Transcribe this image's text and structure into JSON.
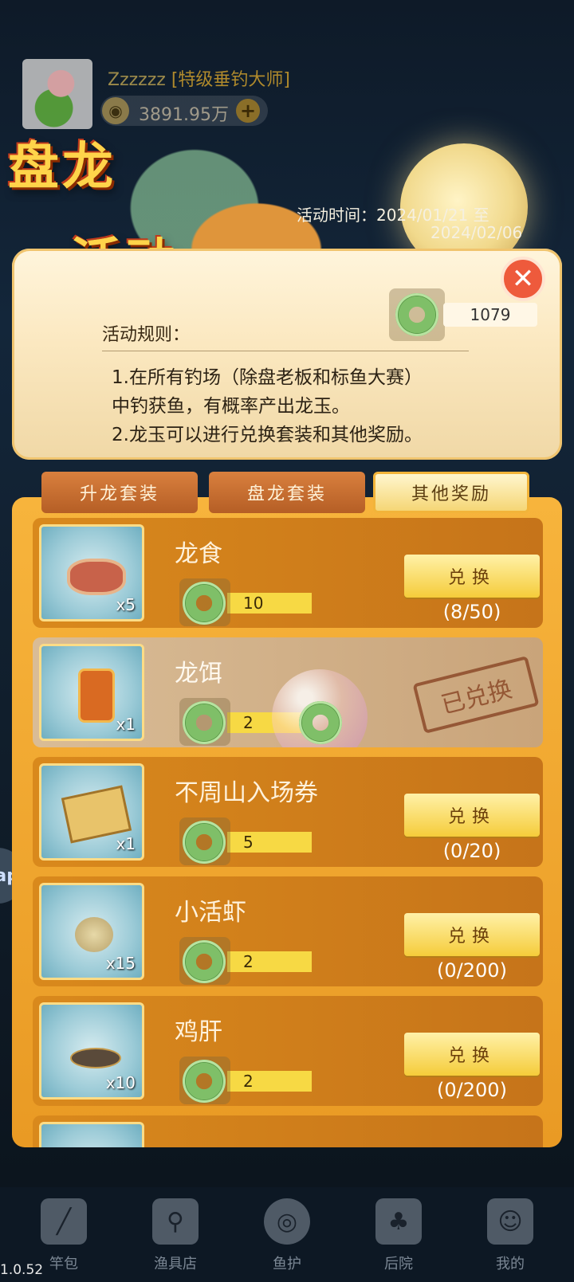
{
  "player": {
    "name": "Zzzzzz",
    "title": "[特级垂钓大师]",
    "coins": "3891.95万"
  },
  "event": {
    "title_line1": "盘龙",
    "title_line2": "活动",
    "time_label": "活动时间：2024/01/21 至",
    "time_end": "2024/02/06",
    "jade_count": "1079",
    "rules_title": "活动规则：",
    "rules": [
      "1.在所有钓场（除盘老板和标鱼大赛）",
      "中钓获鱼，有概率产出龙玉。",
      "2.龙玉可以进行兑换套装和其他奖励。"
    ]
  },
  "tabs": [
    {
      "label": "升龙套装",
      "active": false
    },
    {
      "label": "盘龙套装",
      "active": false
    },
    {
      "label": "其他奖励",
      "active": true
    }
  ],
  "rewards": [
    {
      "name": "龙食",
      "qty": "x5",
      "cost": "10",
      "button": "兑换",
      "count": "(8/50)",
      "claimed": false
    },
    {
      "name": "龙饵",
      "qty": "x1",
      "cost": "2",
      "stamp": "已兑换",
      "claimed": true
    },
    {
      "name": "不周山入场券",
      "qty": "x1",
      "cost": "5",
      "button": "兑换",
      "count": "(0/20)",
      "claimed": false
    },
    {
      "name": "小活虾",
      "qty": "x15",
      "cost": "2",
      "button": "兑换",
      "count": "(0/200)",
      "claimed": false
    },
    {
      "name": "鸡肝",
      "qty": "x10",
      "cost": "2",
      "button": "兑换",
      "count": "(0/200)",
      "claimed": false
    }
  ],
  "nav": [
    {
      "label": "竿包",
      "icon": "rod-bag-icon"
    },
    {
      "label": "渔具店",
      "icon": "tackle-shop-icon"
    },
    {
      "label": "鱼护",
      "icon": "fish-keeper-icon"
    },
    {
      "label": "后院",
      "icon": "backyard-sprout-icon"
    },
    {
      "label": "我的",
      "icon": "profile-icon"
    }
  ],
  "side_tab": "ap",
  "version": "1.0.52",
  "colors": {
    "accent_gold": "#f5cc3a",
    "panel_cream": "#fbe8c0",
    "close_red": "#ee5a3c",
    "jade_green": "#7fbf68"
  }
}
